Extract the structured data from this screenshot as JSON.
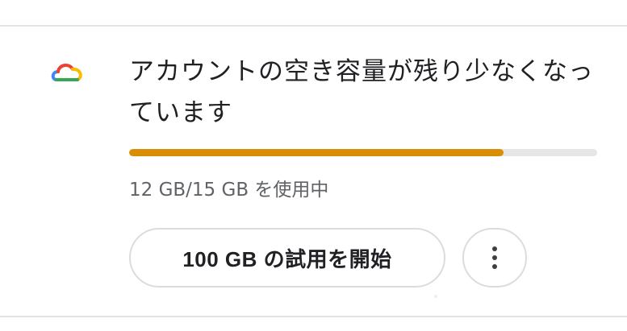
{
  "storage_card": {
    "icon": "google-cloud-icon",
    "title": "アカウントの空き容量が残り少なくなっています",
    "usage_text": "12 GB/15 GB を使用中",
    "usage_fraction": 0.8,
    "progress_color": "#d88f07",
    "track_color": "#e6e6e6",
    "trial_button_label": "100 GB の試用を開始",
    "more_options_icon": "more-vert-icon"
  }
}
